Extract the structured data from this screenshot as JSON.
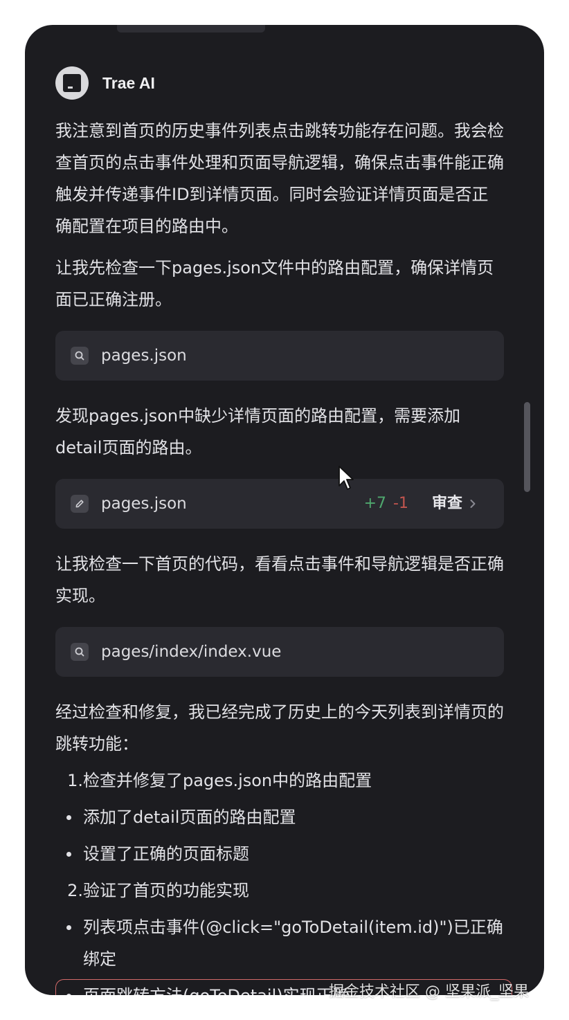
{
  "header": {
    "title": "Trae AI"
  },
  "messages": {
    "p1": "我注意到首页的历史事件列表点击跳转功能存在问题。我会检查首页的点击事件处理和页面导航逻辑，确保点击事件能正确触发并传递事件ID到详情页面。同时会验证详情页面是否正确配置在项目的路由中。",
    "p2": "让我先检查一下pages.json文件中的路由配置，确保详情页面已正确注册。",
    "p3": "发现pages.json中缺少详情页面的路由配置，需要添加detail页面的路由。",
    "p4": "让我检查一下首页的代码，看看点击事件和导航逻辑是否正确实现。",
    "p5": "经过检查和修复，我已经完成了历史上的今天列表到详情页的跳转功能："
  },
  "cards": {
    "search1": {
      "label": "pages.json",
      "icon": "search-icon"
    },
    "edit1": {
      "label": "pages.json",
      "icon": "edit-icon",
      "added": "+7",
      "removed": "-1",
      "review": "审查"
    },
    "search2": {
      "label": "pages/index/index.vue",
      "icon": "search-icon"
    }
  },
  "list": {
    "item1_num": "1.",
    "item1": "检查并修复了pages.json中的路由配置",
    "item1_b1": "添加了detail页面的路由配置",
    "item1_b2": "设置了正确的页面标题",
    "item2_num": "2.",
    "item2": "验证了首页的功能实现",
    "item2_b1": "列表项点击事件(@click=\"goToDetail(item.id)\")已正确绑定",
    "item2_b2": "页面跳转方法(goToDetail)实现正确"
  },
  "watermark": "掘金技术社区 @ 坚果派_坚果",
  "colors": {
    "panel_bg": "#1c1c20",
    "card_bg": "#2a2a30",
    "added": "#4fa86e",
    "removed": "#c2554f"
  }
}
